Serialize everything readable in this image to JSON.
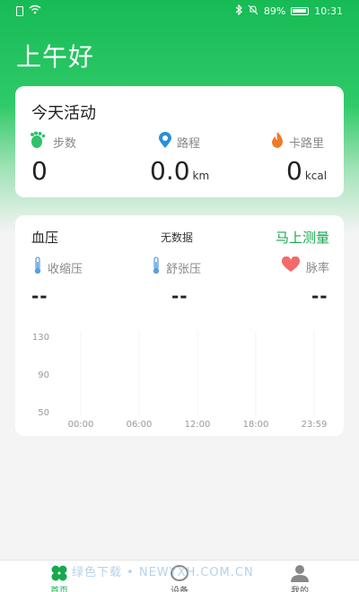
{
  "status_bar": {
    "battery": "89%",
    "time": "10:31"
  },
  "greeting": "上午好",
  "activity": {
    "title": "今天活动",
    "steps": {
      "label": "步数",
      "value": "0"
    },
    "distance": {
      "label": "路程",
      "value": "0.0",
      "unit": "km"
    },
    "calories": {
      "label": "卡路里",
      "value": "0",
      "unit": "kcal"
    }
  },
  "blood_pressure": {
    "title": "血压",
    "status": "无数据",
    "measure_button": "马上测量",
    "systolic": {
      "label": "收缩压",
      "value": "--"
    },
    "diastolic": {
      "label": "舒张压",
      "value": "--"
    },
    "pulse": {
      "label": "脉率",
      "value": "--"
    }
  },
  "chart_data": {
    "type": "line",
    "y_ticks": [
      "130",
      "90",
      "50"
    ],
    "x_ticks": [
      "00:00",
      "06:00",
      "12:00",
      "18:00",
      "23:59"
    ],
    "series": []
  },
  "tabs": [
    {
      "label": "首页",
      "icon": "clover-icon",
      "active": true
    },
    {
      "label": "设备",
      "icon": "device-ring-icon",
      "active": false
    },
    {
      "label": "我的",
      "icon": "user-icon",
      "active": false
    }
  ],
  "watermark": "绿色下载 • NEWYXH.COM.CN",
  "colors": {
    "brand_green": "#18a84e",
    "step_icon": "#2fc26b",
    "distance_icon": "#2a8fd8",
    "calorie_icon": "#f07a2a",
    "thermometer_icon": "#5a9fe0",
    "heart_icon": "#f26a6a"
  }
}
